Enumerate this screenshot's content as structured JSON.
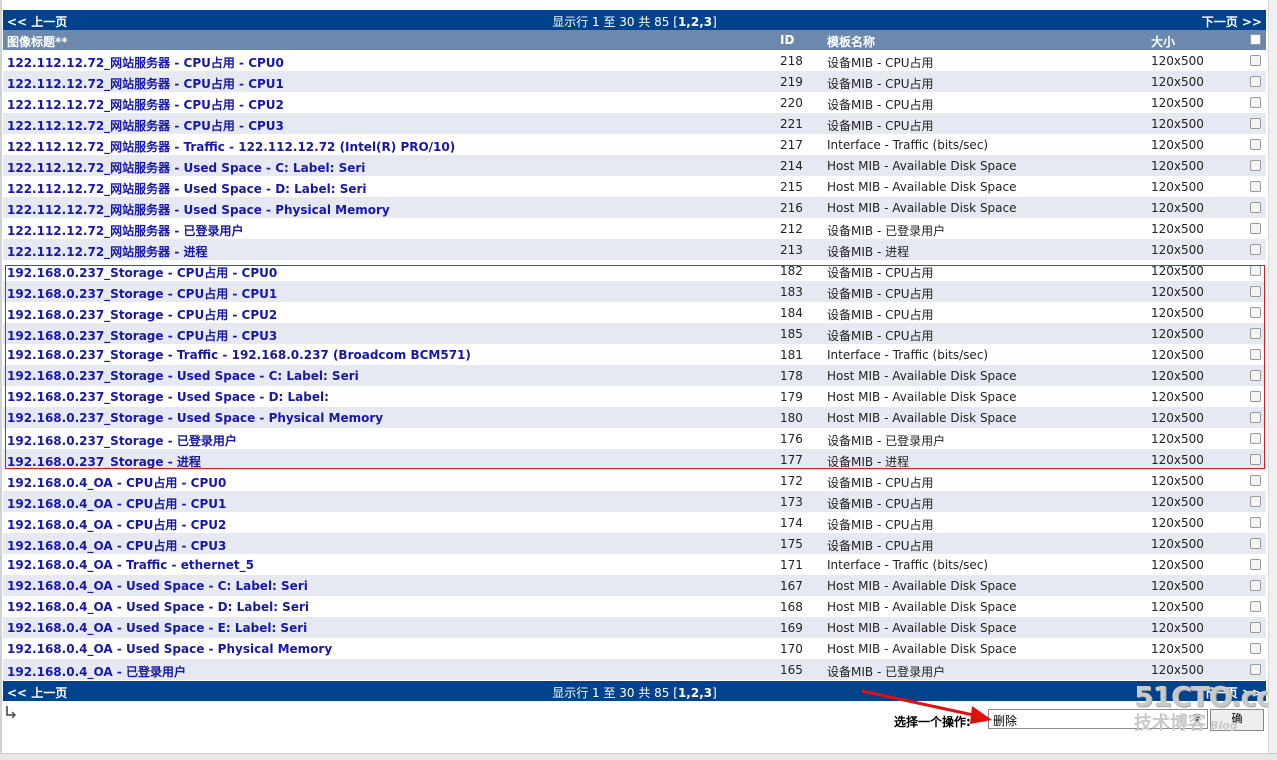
{
  "nav": {
    "prev_label": "<< 上一页",
    "next_label": "下一页 >>",
    "info_prefix": "显示行 1 至 30 共 85 [",
    "info_pages": "1,2,3",
    "info_suffix": "]"
  },
  "header": {
    "title": "图像标题**",
    "id": "ID",
    "template": "模板名称",
    "size": "大小"
  },
  "rows": [
    {
      "title": "122.112.12.72_网站服务器 - CPU占用 - CPU0",
      "id": "218",
      "template": "设备MIB - CPU占用",
      "size": "120x500"
    },
    {
      "title": "122.112.12.72_网站服务器 - CPU占用 - CPU1",
      "id": "219",
      "template": "设备MIB - CPU占用",
      "size": "120x500"
    },
    {
      "title": "122.112.12.72_网站服务器 - CPU占用 - CPU2",
      "id": "220",
      "template": "设备MIB - CPU占用",
      "size": "120x500"
    },
    {
      "title": "122.112.12.72_网站服务器 - CPU占用 - CPU3",
      "id": "221",
      "template": "设备MIB - CPU占用",
      "size": "120x500"
    },
    {
      "title": "122.112.12.72_网站服务器 - Traffic - 122.112.12.72 (Intel(R) PRO/10)",
      "id": "217",
      "template": "Interface - Traffic (bits/sec)",
      "size": "120x500"
    },
    {
      "title": "122.112.12.72_网站服务器 - Used Space - C: Label: Seri",
      "id": "214",
      "template": "Host MIB - Available Disk Space",
      "size": "120x500"
    },
    {
      "title": "122.112.12.72_网站服务器 - Used Space - D: Label: Seri",
      "id": "215",
      "template": "Host MIB - Available Disk Space",
      "size": "120x500"
    },
    {
      "title": "122.112.12.72_网站服务器 - Used Space - Physical Memory",
      "id": "216",
      "template": "Host MIB - Available Disk Space",
      "size": "120x500"
    },
    {
      "title": "122.112.12.72_网站服务器 - 已登录用户",
      "id": "212",
      "template": "设备MIB - 已登录用户",
      "size": "120x500"
    },
    {
      "title": "122.112.12.72_网站服务器 - 进程",
      "id": "213",
      "template": "设备MIB - 进程",
      "size": "120x500"
    },
    {
      "title": "192.168.0.237_Storage - CPU占用 - CPU0",
      "id": "182",
      "template": "设备MIB - CPU占用",
      "size": "120x500"
    },
    {
      "title": "192.168.0.237_Storage - CPU占用 - CPU1",
      "id": "183",
      "template": "设备MIB - CPU占用",
      "size": "120x500"
    },
    {
      "title": "192.168.0.237_Storage - CPU占用 - CPU2",
      "id": "184",
      "template": "设备MIB - CPU占用",
      "size": "120x500"
    },
    {
      "title": "192.168.0.237_Storage - CPU占用 - CPU3",
      "id": "185",
      "template": "设备MIB - CPU占用",
      "size": "120x500"
    },
    {
      "title": "192.168.0.237_Storage - Traffic - 192.168.0.237 (Broadcom BCM571)",
      "id": "181",
      "template": "Interface - Traffic (bits/sec)",
      "size": "120x500"
    },
    {
      "title": "192.168.0.237_Storage - Used Space - C: Label: Seri",
      "id": "178",
      "template": "Host MIB - Available Disk Space",
      "size": "120x500"
    },
    {
      "title": "192.168.0.237_Storage - Used Space - D: Label:",
      "id": "179",
      "template": "Host MIB - Available Disk Space",
      "size": "120x500"
    },
    {
      "title": "192.168.0.237_Storage - Used Space - Physical Memory",
      "id": "180",
      "template": "Host MIB - Available Disk Space",
      "size": "120x500"
    },
    {
      "title": "192.168.0.237_Storage - 已登录用户",
      "id": "176",
      "template": "设备MIB - 已登录用户",
      "size": "120x500"
    },
    {
      "title": "192.168.0.237_Storage - 进程",
      "id": "177",
      "template": "设备MIB - 进程",
      "size": "120x500"
    },
    {
      "title": "192.168.0.4_OA - CPU占用 - CPU0",
      "id": "172",
      "template": "设备MIB - CPU占用",
      "size": "120x500"
    },
    {
      "title": "192.168.0.4_OA - CPU占用 - CPU1",
      "id": "173",
      "template": "设备MIB - CPU占用",
      "size": "120x500"
    },
    {
      "title": "192.168.0.4_OA - CPU占用 - CPU2",
      "id": "174",
      "template": "设备MIB - CPU占用",
      "size": "120x500"
    },
    {
      "title": "192.168.0.4_OA - CPU占用 - CPU3",
      "id": "175",
      "template": "设备MIB - CPU占用",
      "size": "120x500"
    },
    {
      "title": "192.168.0.4_OA - Traffic - ethernet_5",
      "id": "171",
      "template": "Interface - Traffic (bits/sec)",
      "size": "120x500"
    },
    {
      "title": "192.168.0.4_OA - Used Space - C: Label: Seri",
      "id": "167",
      "template": "Host MIB - Available Disk Space",
      "size": "120x500"
    },
    {
      "title": "192.168.0.4_OA - Used Space - D: Label: Seri",
      "id": "168",
      "template": "Host MIB - Available Disk Space",
      "size": "120x500"
    },
    {
      "title": "192.168.0.4_OA - Used Space - E: Label: Seri",
      "id": "169",
      "template": "Host MIB - Available Disk Space",
      "size": "120x500"
    },
    {
      "title": "192.168.0.4_OA - Used Space - Physical Memory",
      "id": "170",
      "template": "Host MIB - Available Disk Space",
      "size": "120x500"
    },
    {
      "title": "192.168.0.4_OA - 已登录用户",
      "id": "165",
      "template": "设备MIB - 已登录用户",
      "size": "120x500"
    }
  ],
  "action": {
    "label": "选择一个操作:",
    "selected": "删除",
    "go_label": "确"
  },
  "watermark": {
    "site": "51CTO.com",
    "sub": "技术博客",
    "blog": "Blog"
  },
  "colors": {
    "nav_bg": "#00438c",
    "header_bg": "#6d88ad",
    "row_alt": "#e7e9f2",
    "link": "#1818a8",
    "highlight_border": "#d02020",
    "arrow": "#e01010"
  }
}
